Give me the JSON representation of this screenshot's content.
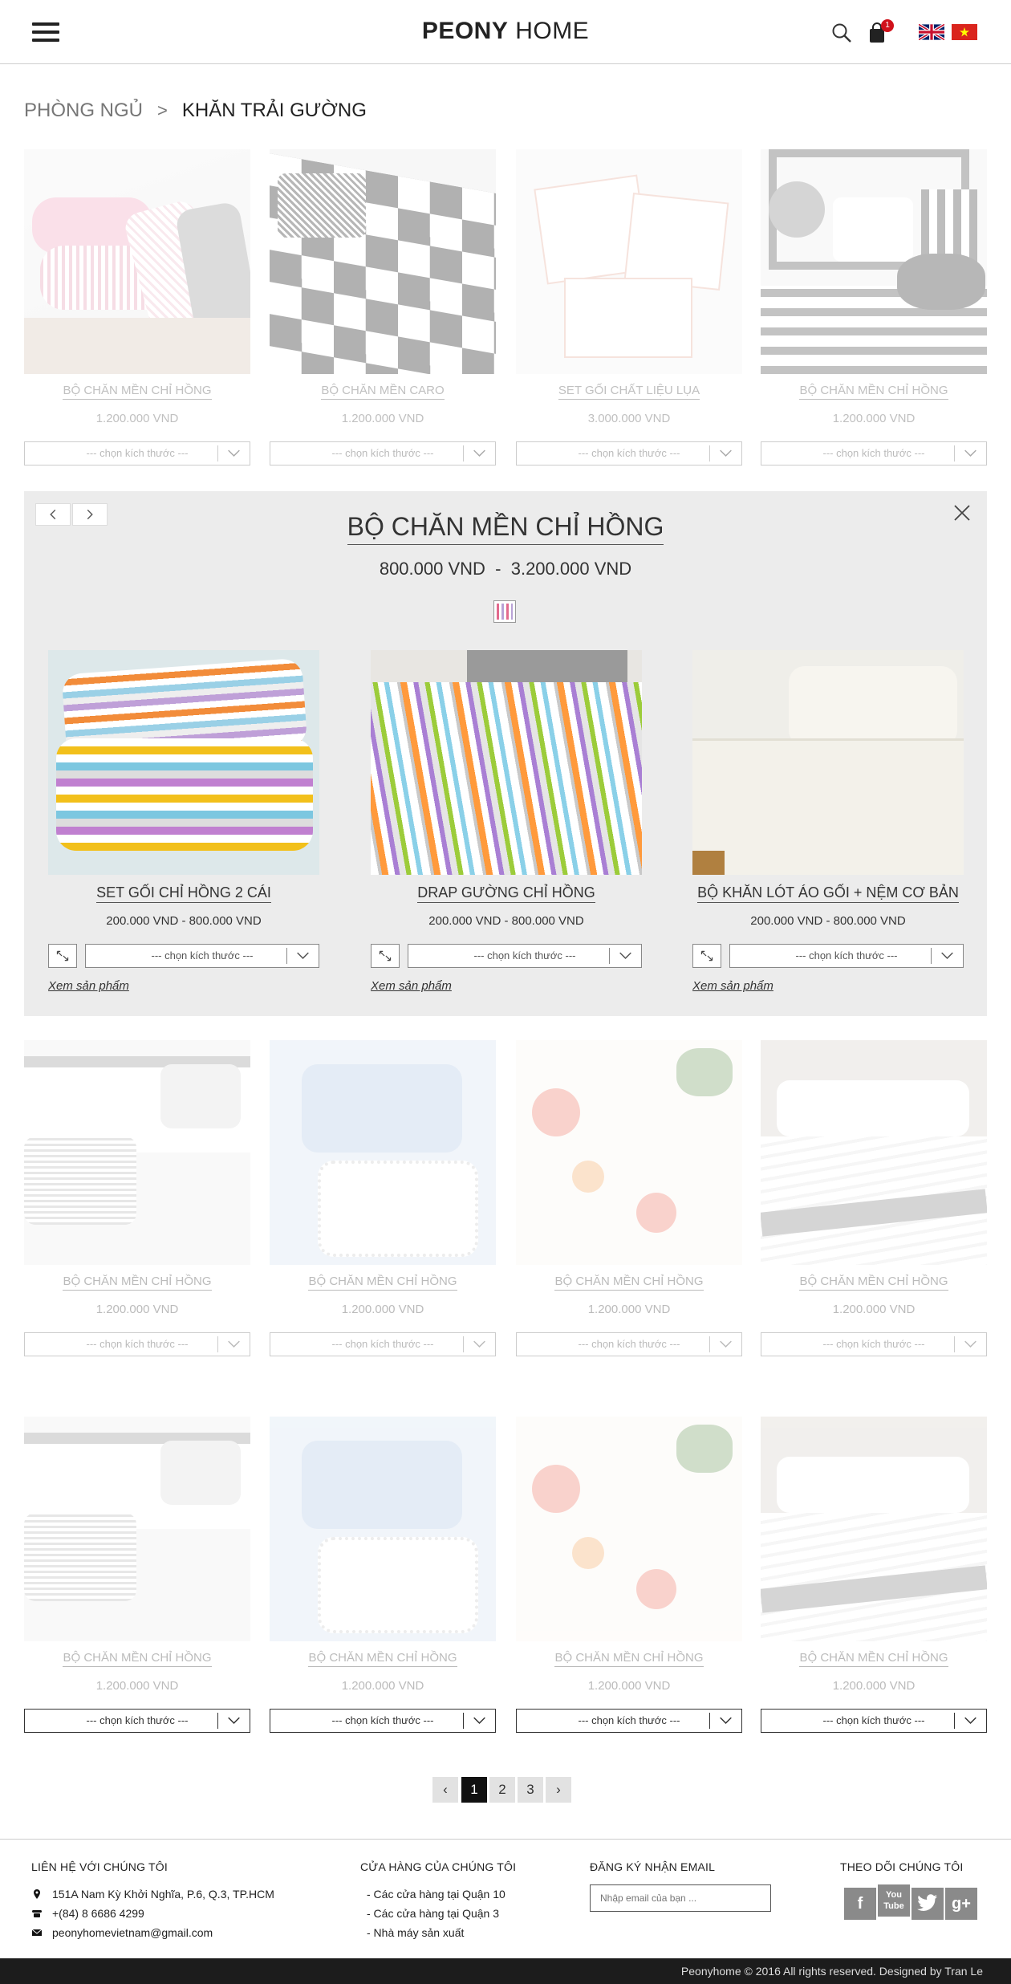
{
  "header": {
    "logo_bold": "PEONY",
    "logo_thin": "HOME",
    "cart_count": "1",
    "icons": [
      "menu-icon",
      "search-icon",
      "cart-icon",
      "flag-uk-icon",
      "flag-vn-icon"
    ]
  },
  "breadcrumb": {
    "parent": "PHÒNG NGỦ",
    "separator": ">",
    "current": "KHĂN TRẢI GƯỜNG"
  },
  "grid_row1": [
    {
      "name": "BỘ CHĂN MỀN CHỈ HỒNG",
      "price": "1.200.000 VND",
      "size_placeholder": "--- chọn kích thước ---"
    },
    {
      "name": "BỘ CHĂN MỀN CARO",
      "price": "1.200.000 VND",
      "size_placeholder": "--- chọn kích thước ---"
    },
    {
      "name": "SET GỐI CHẤT LIỆU LỤA",
      "price": "3.000.000 VND",
      "size_placeholder": "--- chọn kích thước ---"
    },
    {
      "name": "BỘ CHĂN MỀN CHỈ HỒNG",
      "price": "1.200.000 VND",
      "size_placeholder": "--- chọn kích thước ---"
    }
  ],
  "quick_view": {
    "title": "BỘ CHĂN MỀN CHỈ HỒNG",
    "price_from": "800.000 VND",
    "price_sep": "-",
    "price_to": "3.200.000 VND",
    "items": [
      {
        "name": "SET GỐI CHỈ HỒNG 2 CÁI",
        "price": "200.000 VND  -  800.000 VND",
        "size_placeholder": "--- chọn kích thước ---",
        "link": "Xem sản phẩm"
      },
      {
        "name": "DRAP GƯỜNG CHỈ HỒNG",
        "price": "200.000 VND  -  800.000 VND",
        "size_placeholder": "--- chọn kích thước ---",
        "link": "Xem sản phẩm"
      },
      {
        "name": "BỘ KHĂN LÓT ÁO GỐI + NỆM CƠ BẢN",
        "price": "200.000 VND  -  800.000 VND",
        "size_placeholder": "--- chọn kích thước ---",
        "link": "Xem sản phẩm"
      }
    ]
  },
  "grid_row2": [
    {
      "name": "BỘ CHĂN MỀN CHỈ HỒNG",
      "price": "1.200.000 VND",
      "size_placeholder": "--- chọn kích thước ---"
    },
    {
      "name": "BỘ CHĂN MỀN CHỈ HỒNG",
      "price": "1.200.000 VND",
      "size_placeholder": "--- chọn kích thước ---"
    },
    {
      "name": "BỘ CHĂN MỀN CHỈ HỒNG",
      "price": "1.200.000 VND",
      "size_placeholder": "--- chọn kích thước ---"
    },
    {
      "name": "BỘ CHĂN MỀN CHỈ HỒNG",
      "price": "1.200.000 VND",
      "size_placeholder": "--- chọn kích thước ---"
    }
  ],
  "grid_row3": [
    {
      "name": "BỘ CHĂN MỀN CHỈ HỒNG",
      "price": "1.200.000 VND",
      "size_placeholder": "--- chọn kích thước ---"
    },
    {
      "name": "BỘ CHĂN MỀN CHỈ HỒNG",
      "price": "1.200.000 VND",
      "size_placeholder": "--- chọn kích thước ---"
    },
    {
      "name": "BỘ CHĂN MỀN CHỈ HỒNG",
      "price": "1.200.000 VND",
      "size_placeholder": "--- chọn kích thước ---"
    },
    {
      "name": "BỘ CHĂN MỀN CHỈ HỒNG",
      "price": "1.200.000 VND",
      "size_placeholder": "--- chọn kích thước ---"
    }
  ],
  "pagination": {
    "prev": "‹",
    "pages": [
      "1",
      "2",
      "3"
    ],
    "current": "1",
    "next": "›"
  },
  "footer": {
    "contact": {
      "heading": "LIÊN HỆ VỚI CHÚNG TÔI",
      "address": "151A Nam Kỳ Khởi Nghĩa, P.6, Q.3, TP.HCM",
      "phone": "+(84) 8 6686 4299",
      "email": "peonyhomevietnam@gmail.com"
    },
    "stores": {
      "heading": "CỬA HÀNG CỦA CHÚNG TÔI",
      "items": [
        "- Các cửa hàng tại Quận 10",
        "- Các cửa hàng tại Quận 3",
        "- Nhà máy sản xuất"
      ]
    },
    "newsletter": {
      "heading": "ĐĂNG KÝ NHẬN EMAIL",
      "placeholder": "Nhập email của bạn ..."
    },
    "social": {
      "heading": "THEO DÕI CHÚNG TÔI",
      "icons": [
        "facebook-icon",
        "youtube-icon",
        "twitter-icon",
        "google-plus-icon"
      ]
    },
    "copyright": "Peonyhome © 2016 All rights reserved. Designed by Tran Le"
  },
  "colors": {
    "badge": "#d0121b",
    "panel_bg": "#ececec",
    "footer_bar": "#1c1c1c",
    "active_page": "#111111"
  }
}
